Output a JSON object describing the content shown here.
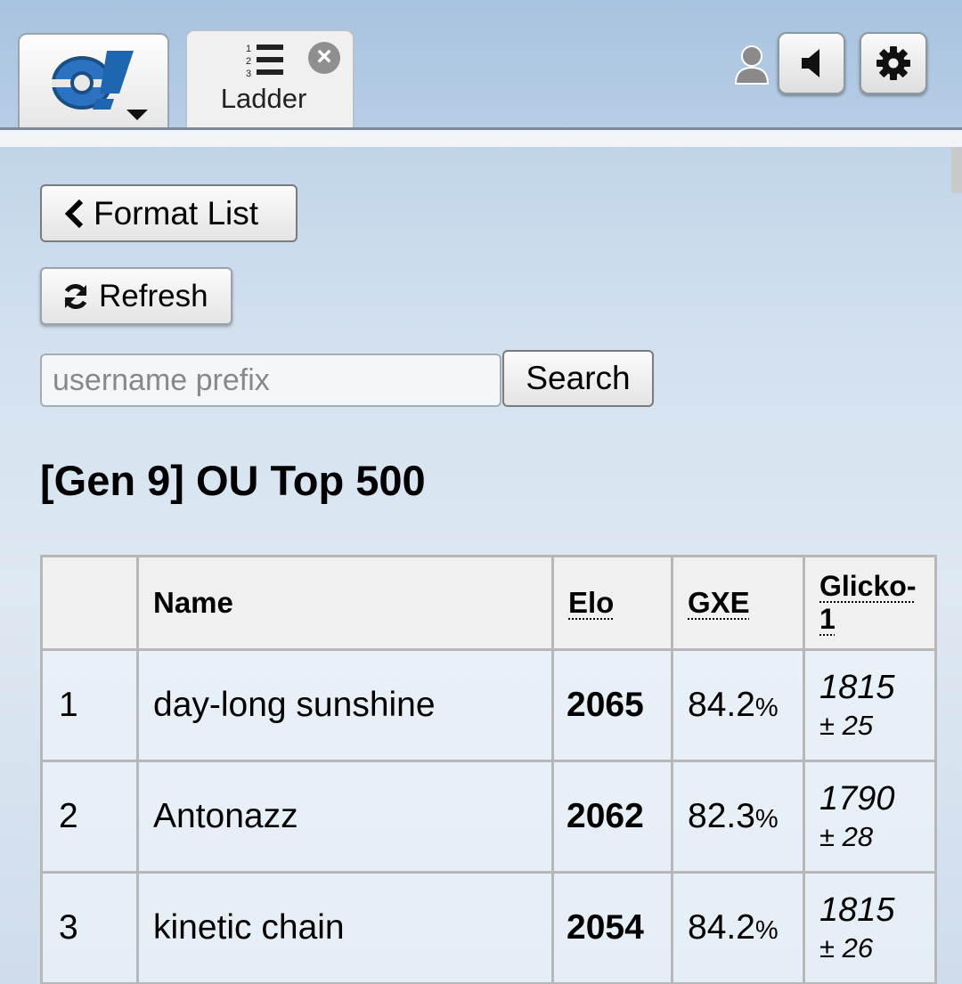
{
  "header": {
    "tab_label": "Ladder",
    "close_symbol": "×"
  },
  "icons": {
    "logo": "showdown-logo-icon",
    "ladder": "numbered-list-icon",
    "user": "user-icon",
    "sound": "speaker-icon",
    "settings": "gear-icon",
    "back": "chevron-left-icon",
    "refresh": "refresh-icon"
  },
  "controls": {
    "format_list_label": "Format List",
    "refresh_label": "Refresh",
    "search_placeholder": "username prefix",
    "search_value": "",
    "search_label": "Search"
  },
  "ladder": {
    "title": "[Gen 9] OU Top 500",
    "columns": {
      "rank": "",
      "name": "Name",
      "elo": "Elo",
      "gxe": "GXE",
      "glicko": "Glicko-1",
      "glicko_line1": "Glicko-",
      "glicko_line2": "1"
    },
    "rows": [
      {
        "rank": "1",
        "name": "day-long sunshine",
        "elo": "2065",
        "gxe": "84.2",
        "pct": "%",
        "glicko": "1815",
        "deviation": "± 25"
      },
      {
        "rank": "2",
        "name": "Antonazz",
        "elo": "2062",
        "gxe": "82.3",
        "pct": "%",
        "glicko": "1790",
        "deviation": "± 28"
      },
      {
        "rank": "3",
        "name": "kinetic chain",
        "elo": "2054",
        "gxe": "84.2",
        "pct": "%",
        "glicko": "1815",
        "deviation": "± 26"
      }
    ]
  },
  "colors": {
    "accent": "#1a5fa8",
    "border": "#b7b7b7"
  }
}
